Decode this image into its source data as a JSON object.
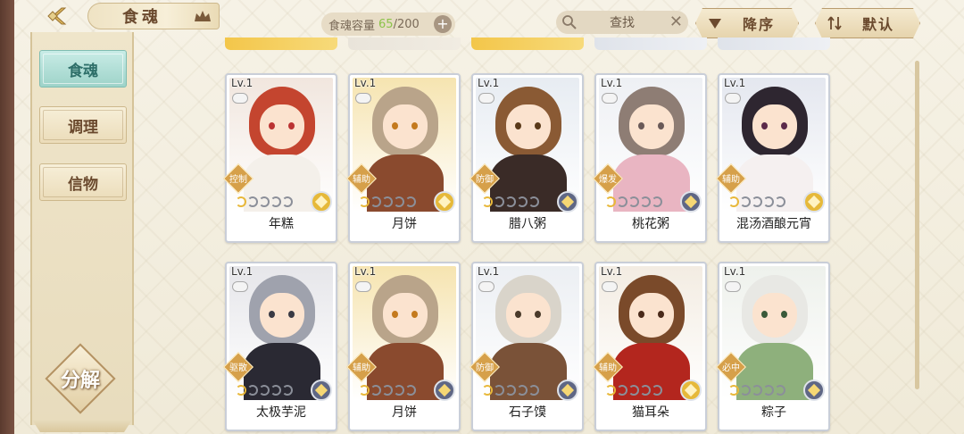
{
  "header": {
    "title": "食魂",
    "capacity_label": "食魂容量",
    "capacity_current": "65",
    "capacity_max": "/200",
    "plus": "+",
    "search_label": "查找",
    "search_clear": "✕",
    "sort_order": "降序",
    "sort_mode": "默认"
  },
  "sidebar": {
    "items": [
      {
        "label": "食魂",
        "active": true
      },
      {
        "label": "调理",
        "active": false
      },
      {
        "label": "信物",
        "active": false
      }
    ],
    "decompose_label": "分解"
  },
  "cards": [
    {
      "level": "Lv.1",
      "name": "年糕",
      "role": "控制",
      "stars_on": 1,
      "element": "gold",
      "hair": "#c4452f",
      "body": "#f4f0ea",
      "bg": "#f1e6de",
      "eye": "#b33"
    },
    {
      "level": "Lv.1",
      "name": "月饼",
      "role": "辅助",
      "stars_on": 1,
      "element": "gold",
      "hair": "#b9a48a",
      "body": "#8a4a2e",
      "bg": "#f6e4b0",
      "eye": "#c47a1e"
    },
    {
      "level": "Lv.1",
      "name": "腊八粥",
      "role": "防御",
      "stars_on": 1,
      "element": "dark",
      "hair": "#8a5a34",
      "body": "#3a2b27",
      "bg": "#e7ecf2",
      "eye": "#5a3a1a"
    },
    {
      "level": "Lv.1",
      "name": "桃花粥",
      "role": "爆发",
      "stars_on": 1,
      "element": "dark",
      "hair": "#8e7d74",
      "body": "#e9b5c2",
      "bg": "#eef0f4",
      "eye": "#6a5a58"
    },
    {
      "level": "Lv.1",
      "name": "混汤酒酿元宵",
      "role": "辅助",
      "stars_on": 1,
      "element": "gold",
      "hair": "#2e2630",
      "body": "#f5f0f0",
      "bg": "#e4e7ef",
      "eye": "#5b2a4a"
    },
    {
      "level": "Lv.1",
      "name": "太极芋泥",
      "role": "驱散",
      "stars_on": 1,
      "element": "dark",
      "hair": "#9fa2ad",
      "body": "#2a2933",
      "bg": "#e6e6ea",
      "eye": "#3a3a44"
    },
    {
      "level": "Lv.1",
      "name": "月饼",
      "role": "辅助",
      "stars_on": 1,
      "element": "dark",
      "hair": "#b9a48a",
      "body": "#8a4a2e",
      "bg": "#f6e4b0",
      "eye": "#c47a1e"
    },
    {
      "level": "Lv.1",
      "name": "石子馍",
      "role": "防御",
      "stars_on": 1,
      "element": "dark",
      "hair": "#d9d4ca",
      "body": "#7a5238",
      "bg": "#eceff3",
      "eye": "#4a3a2a"
    },
    {
      "level": "Lv.1",
      "name": "猫耳朵",
      "role": "辅助",
      "stars_on": 1,
      "element": "gold",
      "hair": "#7a4a2a",
      "body": "#b3261e",
      "bg": "#f3ece2",
      "eye": "#4a2a1a"
    },
    {
      "level": "Lv.1",
      "name": "粽子",
      "role": "必中",
      "stars_on": 1,
      "element": "dark",
      "hair": "#e8e8e4",
      "body": "#8eb07c",
      "bg": "#eef1ec",
      "eye": "#3a5a3a"
    }
  ],
  "colors": {
    "active_tab": "#9ed3c9",
    "accent_gold": "#e8b83a",
    "capacity_current": "#8cc34a"
  }
}
